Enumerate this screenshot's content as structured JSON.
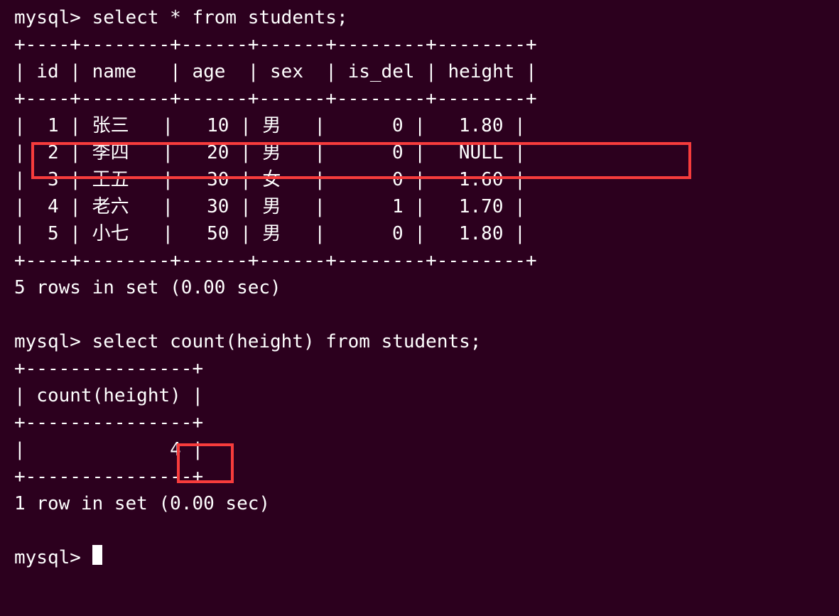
{
  "terminal": {
    "prompt": "mysql>",
    "query1": "select * from students;",
    "table1": {
      "border_top": "+----+--------+------+------+--------+--------+",
      "header": "| id | name   | age  | sex  | is_del | height |",
      "border_mid": "+----+--------+------+------+--------+--------+",
      "rows": [
        "|  1 | 张三   |   10 | 男   |      0 |   1.80 |",
        "|  2 | 李四   |   20 | 男   |      0 |   NULL |",
        "|  3 | 王五   |   30 | 女   |      0 |   1.60 |",
        "|  4 | 老六   |   30 | 男   |      1 |   1.70 |",
        "|  5 | 小七   |   50 | 男   |      0 |   1.80 |"
      ],
      "border_bot": "+----+--------+------+------+--------+--------+",
      "status": "5 rows in set (0.00 sec)"
    },
    "query2": "select count(height) from students;",
    "table2": {
      "border_top": "+---------------+",
      "header": "| count(height) |",
      "border_mid": "+---------------+",
      "row": "|             4 |",
      "border_bot": "+---------------+",
      "status": "1 row in set (0.00 sec)"
    }
  }
}
